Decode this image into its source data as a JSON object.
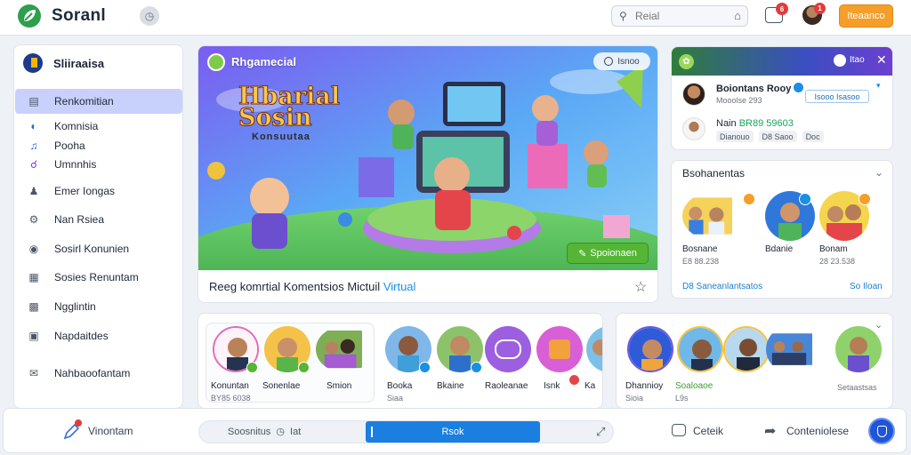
{
  "app": {
    "title": "Soranl",
    "brand_color": "#2e9e4f",
    "logo_icon": "leaf-logo-icon",
    "round_button_icon": "clock-icon"
  },
  "header": {
    "search_placeholder": "Reial",
    "search_icon": "search-icon",
    "notifications_badge": "6",
    "avatar_badge": "1",
    "upgrade_label": "Iteaanco",
    "upgrade_color": "#f59e2a"
  },
  "sidebar": {
    "title": "Sliiraaisa",
    "items": [
      {
        "label": "Renkomitian",
        "icon": "list-icon",
        "active": true
      },
      {
        "label": "Komnisia",
        "icon": "circle-icon"
      },
      {
        "label": "Pooha",
        "icon": "music-icon"
      },
      {
        "label": "Umnnhis",
        "icon": "user-outline-icon"
      },
      {
        "label": "Emer Iongas",
        "icon": "person-icon"
      },
      {
        "label": "Nan Rsiea",
        "icon": "gear-icon"
      },
      {
        "label": "Sosirl Konunien",
        "icon": "globe-icon"
      },
      {
        "label": "Sosies Renuntam",
        "icon": "folder-icon"
      },
      {
        "label": "Ngglintin",
        "icon": "doc-icon"
      },
      {
        "label": "Napdaitdes",
        "icon": "box-icon"
      },
      {
        "label": "Nahbaoofantam",
        "icon": "mail-icon"
      }
    ]
  },
  "hero": {
    "label": "Rhgamecial",
    "pill_label": "Isnoo",
    "art_title_line1": "Hbarial",
    "art_title_line2": "Sosin",
    "art_subtitle": "Konsuutaa",
    "cta_label": "Spoionaen",
    "caption_main": "Reeg komrtial Komentsios Mictuil",
    "caption_accent": "Virtual",
    "accent_color": "#1a8fe3"
  },
  "right_card_top": {
    "title": "Itao",
    "row1": {
      "name": "Boiontans Rooy",
      "meta": "Mooolse 293",
      "chip": "Isooo Isasoo"
    },
    "row2": {
      "name_prefix": "Nain",
      "name_accent": "BR89 59603",
      "tags": [
        "Dianouo",
        "D8 Saoo",
        "Doc"
      ]
    }
  },
  "right_card_people": {
    "title": "Bsohanentas",
    "people": [
      {
        "name": "Bosnane",
        "meta": "E8 88.238"
      },
      {
        "name": "Bdanie",
        "meta": ""
      },
      {
        "name": "Bonam",
        "meta": "28 23.538"
      }
    ],
    "footer_left": "D8 Saneanlantsatos",
    "footer_right": "So Iloan"
  },
  "panel_people": {
    "tiles": [
      {
        "name": "Konuntan",
        "meta": "BY85 6038"
      },
      {
        "name": "Sonenlae",
        "meta": ""
      },
      {
        "name": "Smion",
        "meta": ""
      },
      {
        "name": "Booka",
        "meta": "Siaa"
      },
      {
        "name": "Bkaine",
        "meta": ""
      },
      {
        "name": "Raoleanae",
        "meta": ""
      },
      {
        "name": "Isnk",
        "meta": ""
      },
      {
        "name": "Ka",
        "meta": ""
      }
    ]
  },
  "panel_right": {
    "tiles": [
      {
        "name": "Dhannioy",
        "meta": "Sioia"
      },
      {
        "name": "Soaloaoe",
        "meta": "L9s"
      }
    ],
    "footer": "Setaastsas"
  },
  "bottom_bar": {
    "left_label": "Vinontam",
    "segment_left": "Soosnitus",
    "segment_left_suffix": "Iat",
    "segment_active": "Rsok",
    "chat_label": "Ceteik",
    "share_label": "Conteniolese",
    "active_color": "#1a7fe0"
  }
}
